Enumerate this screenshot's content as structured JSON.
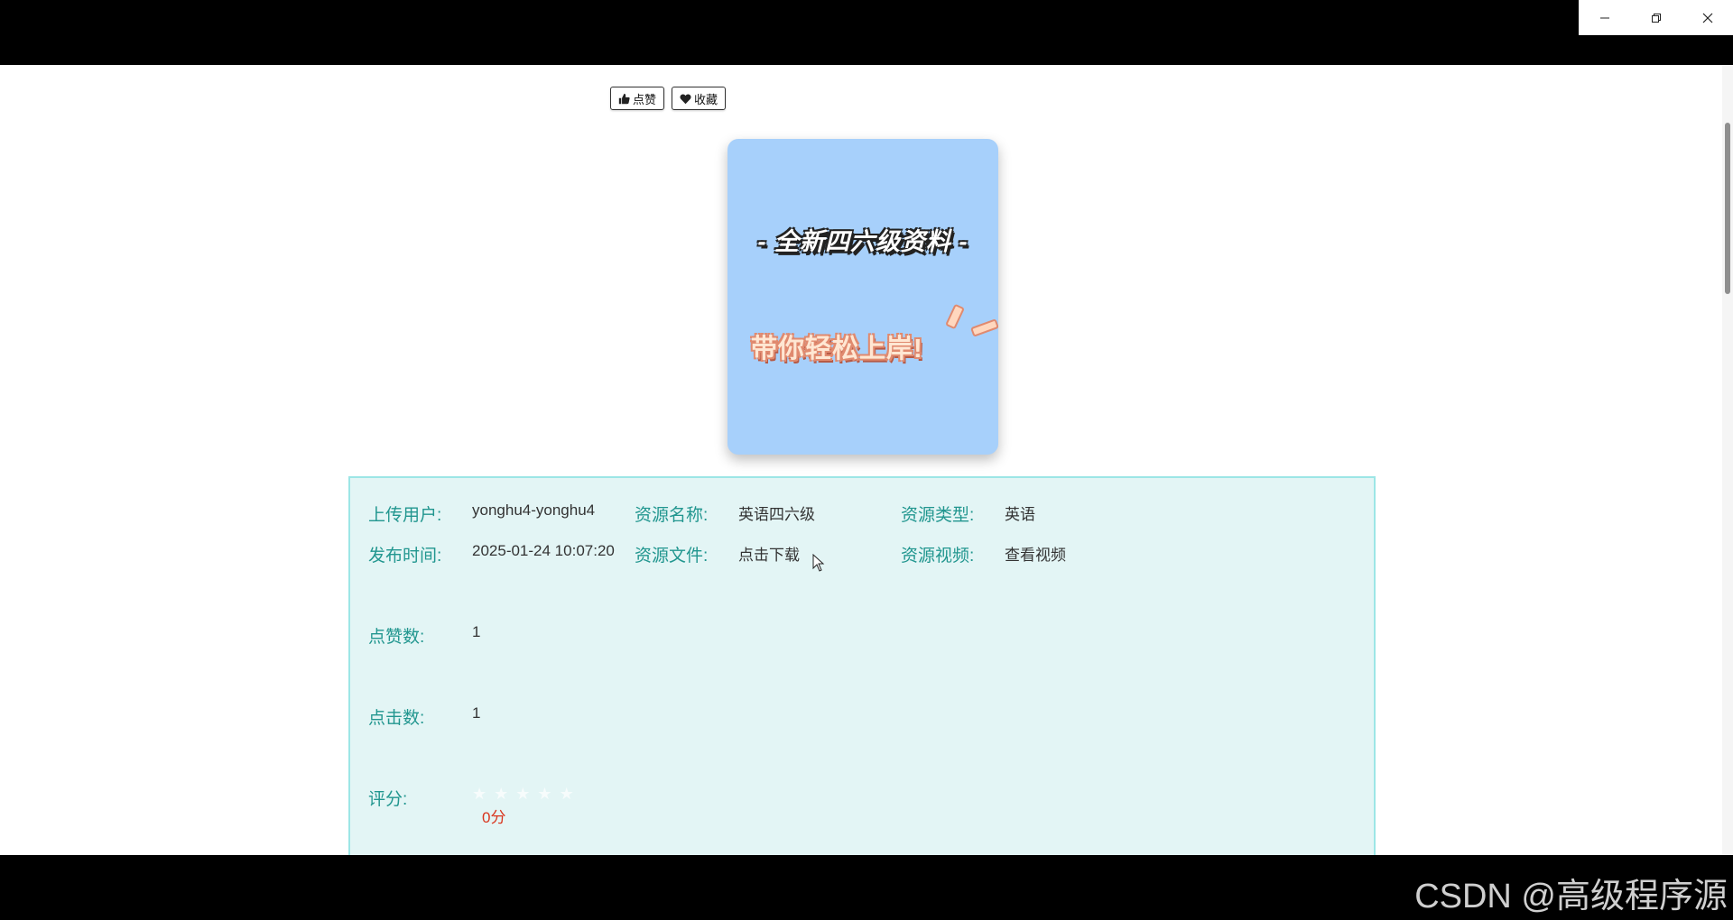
{
  "window": {
    "minimize_icon": "minimize-icon",
    "restore_icon": "restore-icon",
    "close_icon": "close-icon"
  },
  "actions": {
    "like_label": "点赞",
    "collect_label": "收藏",
    "like_icon": "thumbs-up-icon",
    "collect_icon": "heart-icon"
  },
  "cover": {
    "line1": "- 全新四六级资料 -",
    "line2": "带你轻松上岸!",
    "background_color": "#a7d0fb"
  },
  "info": {
    "uploader_label": "上传用户:",
    "uploader_value": "yonghu4-yonghu4",
    "name_label": "资源名称:",
    "name_value": "英语四六级",
    "type_label": "资源类型:",
    "type_value": "英语",
    "time_label": "发布时间:",
    "time_value": "2025-01-24 10:07:20",
    "file_label": "资源文件:",
    "file_value": "点击下载",
    "video_label": "资源视频:",
    "video_value": "查看视频",
    "likes_label": "点赞数:",
    "likes_value": "1",
    "clicks_label": "点击数:",
    "clicks_value": "1",
    "rating_label": "评分:",
    "rating_value": "0分",
    "rating_stars": 0
  },
  "watermark": "CSDN @高级程序源",
  "colors": {
    "label": "#21968f",
    "panel_bg": "#e3f5f5",
    "panel_border": "#9ce6e6",
    "score": "#d9361f"
  }
}
